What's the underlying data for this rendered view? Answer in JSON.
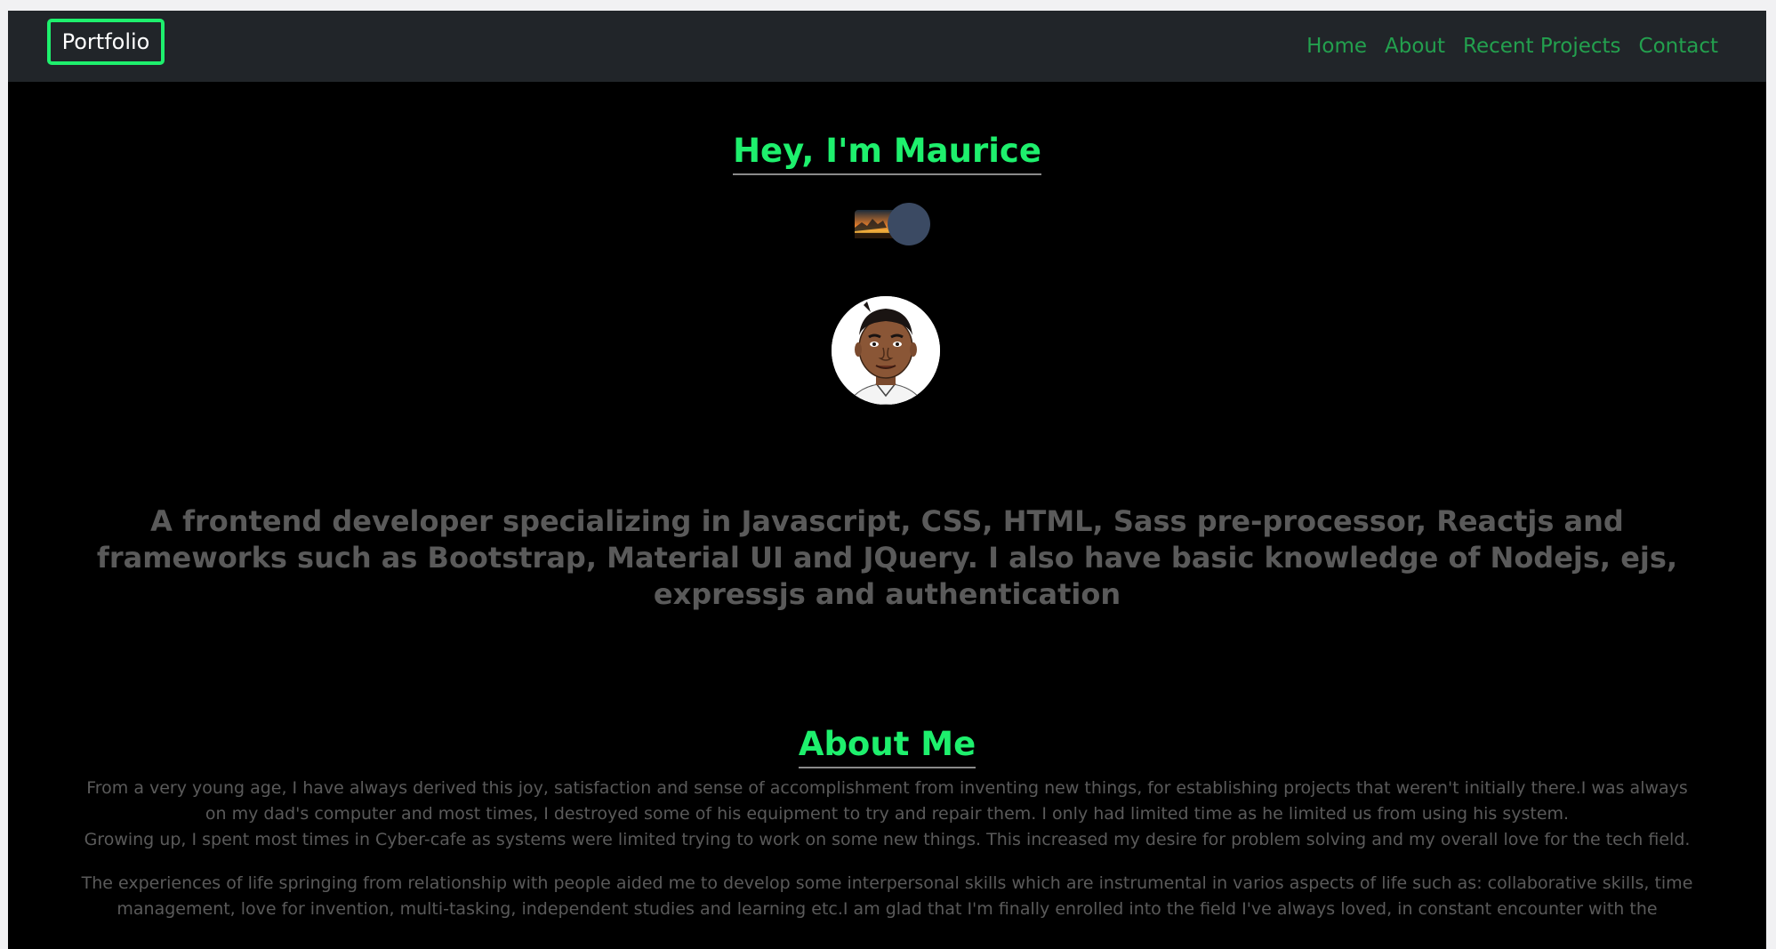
{
  "navbar": {
    "brand": "Portfolio",
    "links": [
      "Home",
      "About",
      "Recent Projects",
      "Contact"
    ]
  },
  "hero": {
    "title": "Hey, I'm Maurice",
    "tagline": "A frontend developer specializing in Javascript, CSS, HTML, Sass pre-processor, Reactjs and frameworks such as Bootstrap, Material UI and JQuery. I also have basic knowledge of Nodejs, ejs, expressjs and authentication"
  },
  "about": {
    "title": "About Me",
    "paragraph1": "From a very young age, I have always derived this joy, satisfaction and sense of accomplishment from inventing new things, for establishing projects that weren't initially there.I was always on my dad's computer and most times, I destroyed some of his equipment to try and repair them. I only had limited time as he limited us from using his system.",
    "paragraph2": "Growing up, I spent most times in Cyber-cafe as systems were limited trying to work on some new things. This increased my desire for problem solving and my overall love for the tech field.",
    "paragraph3": "The experiences of life springing from relationship with people aided me to develop some interpersonal skills which are instrumental in varios aspects of life such as: collaborative skills, time management, love for invention, multi-tasking, independent studies and learning etc.I am glad that I'm finally enrolled into the field I've always loved, in constant encounter with the"
  },
  "icons": {
    "toggle": "theme-toggle-icon",
    "avatar": "avatar"
  },
  "colors": {
    "accent": "#1ef06d",
    "nav_link": "#23a04e",
    "navbar_bg": "#212529",
    "page_bg": "#000000",
    "body_text": "#5a5a5a"
  }
}
